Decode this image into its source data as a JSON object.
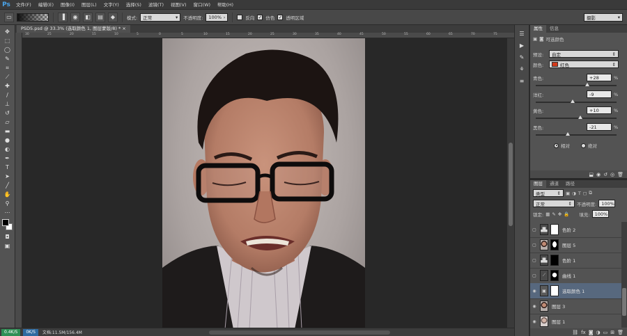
{
  "app": {
    "logo": "Ps"
  },
  "menu": [
    "文件(F)",
    "编辑(E)",
    "图像(I)",
    "图层(L)",
    "文字(Y)",
    "选择(S)",
    "滤镜(T)",
    "视图(V)",
    "窗口(W)",
    "帮助(H)"
  ],
  "options": {
    "mode_label": "模式:",
    "mode_value": "正常",
    "opacity_label": "不透明度:",
    "opacity_value": "100%",
    "reverse_label": "反向",
    "dither_label": "仿色",
    "transparency_label": "透明区域",
    "workspace_value": "摄影"
  },
  "document": {
    "tab_title": "PSD5.psd @ 33.3% (选取颜色 1, 图层蒙版/8) *",
    "ruler_ticks": [
      "30",
      "25",
      "20",
      "15",
      "10",
      "5",
      "0",
      "5",
      "10",
      "15",
      "20",
      "25",
      "30",
      "35",
      "40",
      "45",
      "50",
      "55",
      "60",
      "65",
      "70",
      "75"
    ]
  },
  "status": {
    "net_up": "0.4K/S",
    "net_down": "0K/S",
    "doc_size": "文档:11.5M/156.4M"
  },
  "properties": {
    "tabs": [
      "属性",
      "信息"
    ],
    "title": "可选颜色",
    "preset_label": "预设:",
    "preset_value": "自定",
    "colors_label": "颜色:",
    "colors_value": "红色",
    "colors_swatch": "#d43a1a",
    "sliders": [
      {
        "label": "青色:",
        "value": "+28",
        "unit": "%",
        "position": 0.64
      },
      {
        "label": "洋红:",
        "value": "-9",
        "unit": "%",
        "position": 0.455
      },
      {
        "label": "黄色:",
        "value": "+10",
        "unit": "%",
        "position": 0.55
      },
      {
        "label": "黑色:",
        "value": "-21",
        "unit": "%",
        "position": 0.395
      }
    ],
    "method_relative": "相对",
    "method_absolute": "绝对"
  },
  "layers_panel": {
    "tabs": [
      "图层",
      "通道",
      "路径"
    ],
    "filter_value": "类型",
    "blend_value": "正常",
    "opacity_label": "不透明度:",
    "opacity_value": "100%",
    "lock_label": "锁定:",
    "fill_label": "填充:",
    "fill_value": "100%",
    "layers": [
      {
        "name": "色阶 2",
        "thumb": "levels",
        "mask": "white",
        "visible": false
      },
      {
        "name": "图层 5",
        "thumb": "face",
        "mask": "silhouette",
        "visible": false
      },
      {
        "name": "色阶 1",
        "thumb": "levels",
        "mask": "black",
        "visible": false
      },
      {
        "name": "曲线 1",
        "thumb": "curves",
        "mask": "spot",
        "visible": false
      },
      {
        "name": "选取颜色 1",
        "thumb": "selective",
        "mask": "white",
        "visible": true,
        "selected": true
      },
      {
        "name": "图层 3",
        "thumb": "face",
        "mask": "",
        "visible": true
      },
      {
        "name": "图层 1",
        "thumb": "face-light",
        "mask": "",
        "visible": true
      }
    ]
  },
  "colors": {
    "selected_layer": "#57687e",
    "ps_blue": "#4aa3e8",
    "net_up_bg": "#2e8f55",
    "net_down_bg": "#2e6aa0"
  }
}
